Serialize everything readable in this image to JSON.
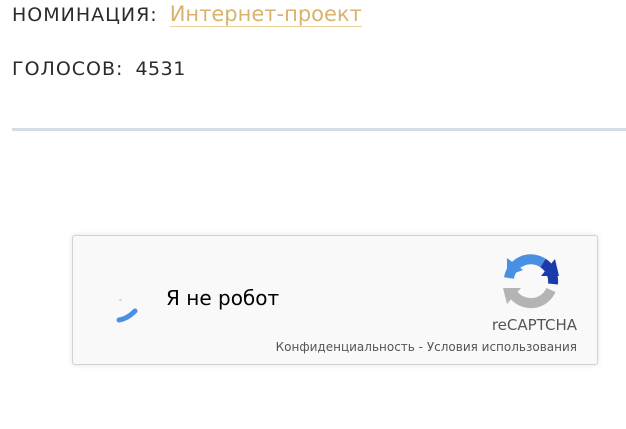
{
  "nomination": {
    "label": "НОМИНАЦИЯ:",
    "value": "Интернет-проект"
  },
  "votes": {
    "label": "ГОЛОСОВ:",
    "count": "4531"
  },
  "recaptcha": {
    "checkbox_label": "Я не робот",
    "brand": "reCAPTCHA",
    "privacy_link": "Конфиденциальность",
    "separator": " - ",
    "terms_link": "Условия использования",
    "logo_icon": "recaptcha-logo-icon",
    "spinner_icon": "loading-spinner-icon"
  },
  "colors": {
    "accent": "#d9b36b",
    "text": "#2b2b2b",
    "divider": "#d5dde6",
    "recaptcha_blue": "#1c5dd8",
    "recaptcha_light_blue": "#4a90e2",
    "recaptcha_gray": "#b4b4b4"
  }
}
